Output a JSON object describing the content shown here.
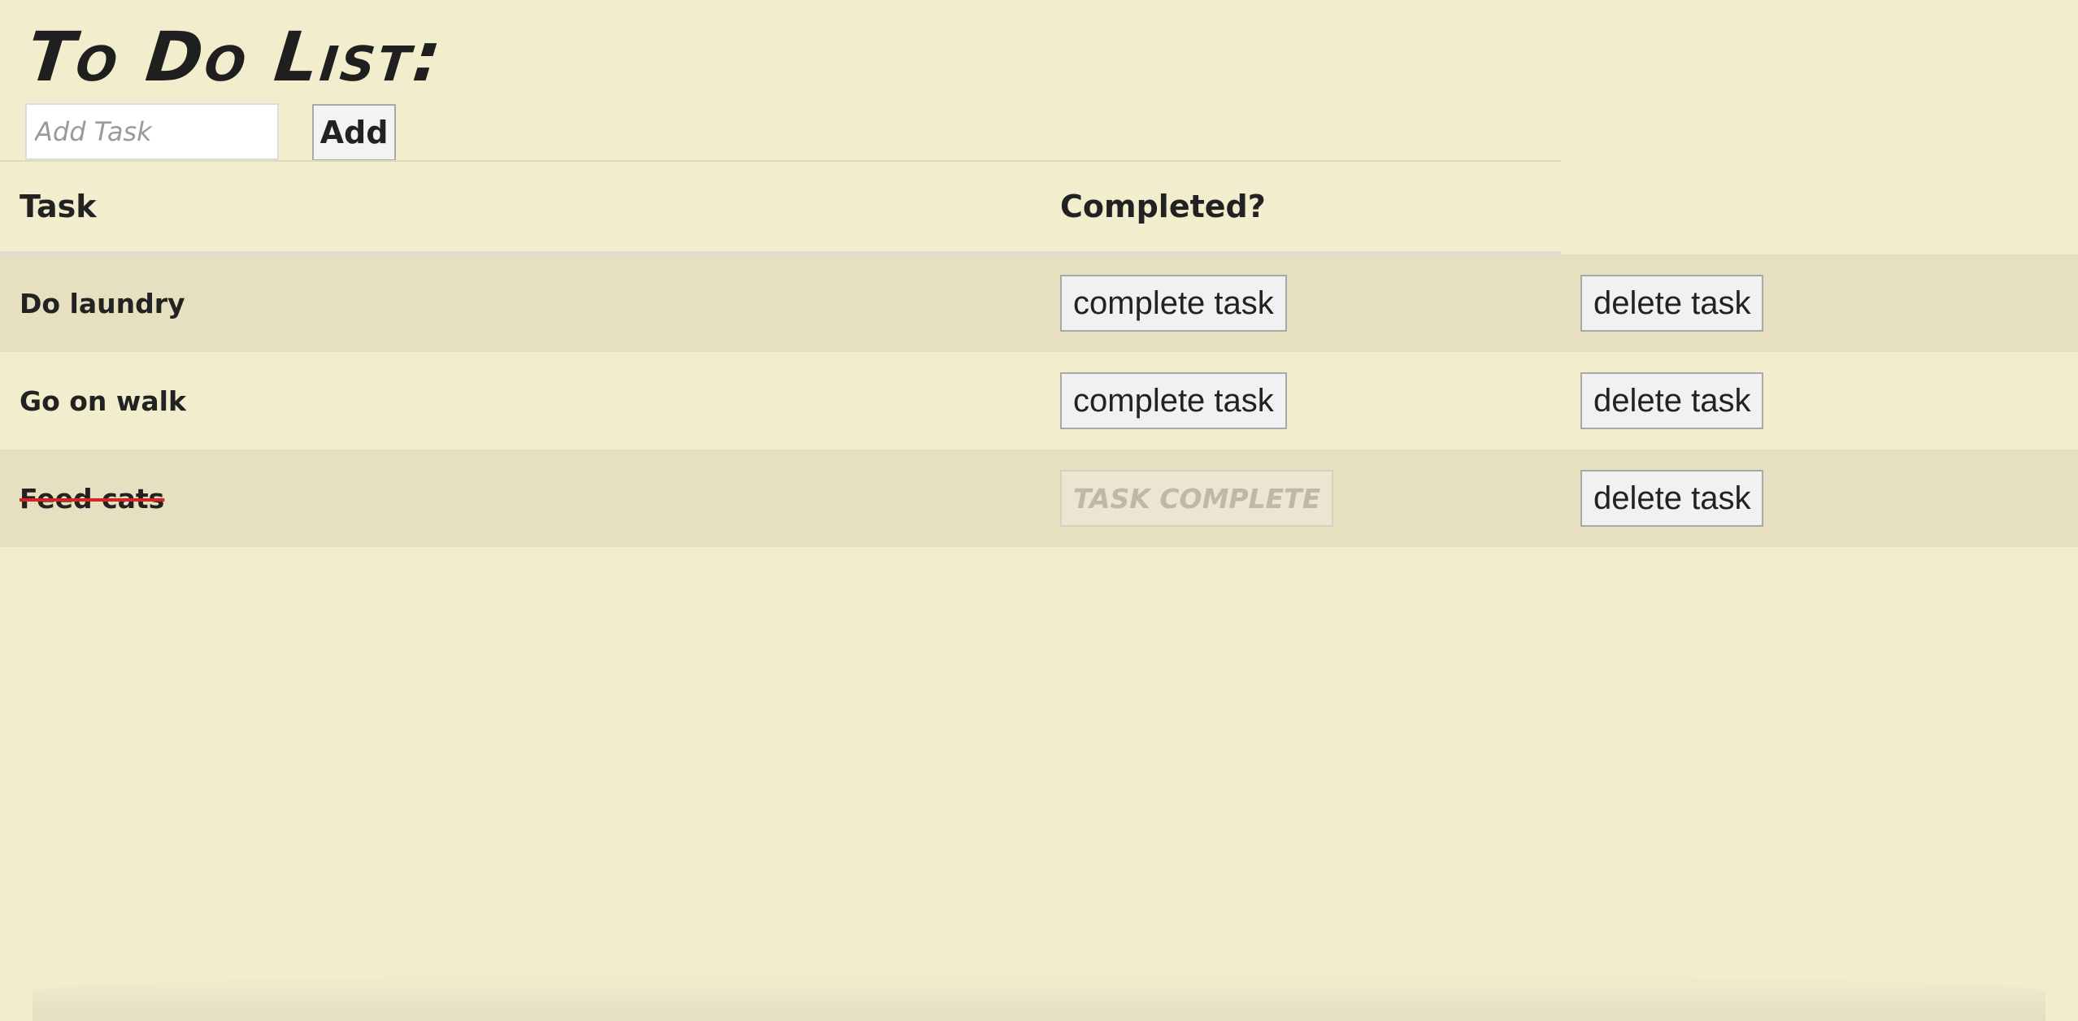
{
  "app": {
    "title": "To Do List:"
  },
  "add_form": {
    "input_placeholder": "Add Task",
    "input_value": "",
    "add_label": "Add"
  },
  "table": {
    "headers": {
      "task": "Task",
      "completed": "Completed?",
      "actions": ""
    },
    "rows": [
      {
        "task": "Do laundry",
        "completed": false,
        "complete_label": "complete task",
        "delete_label": "delete task"
      },
      {
        "task": "Go on walk",
        "completed": false,
        "complete_label": "complete task",
        "delete_label": "delete task"
      },
      {
        "task": "Feed cats",
        "completed": true,
        "complete_label": "Task Complete",
        "delete_label": "delete task"
      }
    ]
  },
  "colors": {
    "background": "#f2edcd",
    "row_stripe": "#e6e0c1",
    "strikethrough": "#dd2222"
  }
}
